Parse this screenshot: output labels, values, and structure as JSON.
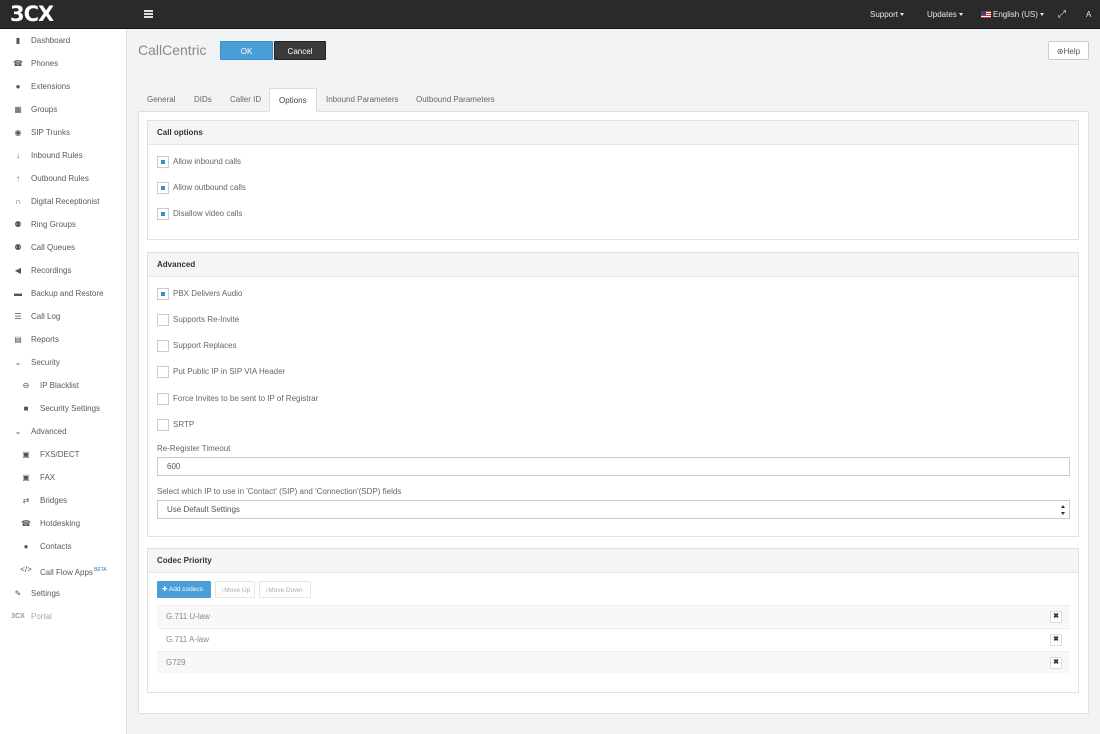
{
  "app": {
    "logo": "3CX"
  },
  "topbar": {
    "support": "Support",
    "updates": "Updates",
    "language": "English (US)",
    "user": "A"
  },
  "sidebar": {
    "items": [
      {
        "label": "Dashboard",
        "icon": "bar-chart-icon"
      },
      {
        "label": "Phones",
        "icon": "phone-icon"
      },
      {
        "label": "Extensions",
        "icon": "user-icon"
      },
      {
        "label": "Groups",
        "icon": "grid-icon"
      },
      {
        "label": "SIP Trunks",
        "icon": "globe-icon"
      },
      {
        "label": "Inbound Rules",
        "icon": "arrow-down-icon"
      },
      {
        "label": "Outbound Rules",
        "icon": "arrow-up-icon"
      },
      {
        "label": "Digital Receptionist",
        "icon": "headset-icon"
      },
      {
        "label": "Ring Groups",
        "icon": "users-icon"
      },
      {
        "label": "Call Queues",
        "icon": "users-icon"
      },
      {
        "label": "Recordings",
        "icon": "speaker-icon"
      },
      {
        "label": "Backup and Restore",
        "icon": "folder-icon"
      },
      {
        "label": "Call Log",
        "icon": "list-icon"
      },
      {
        "label": "Reports",
        "icon": "document-icon"
      },
      {
        "label": "Security",
        "icon": "chevron-down-icon"
      },
      {
        "label": "IP Blacklist",
        "icon": "minus-circle-icon"
      },
      {
        "label": "Security Settings",
        "icon": "lock-icon"
      },
      {
        "label": "Advanced",
        "icon": "chevron-down-icon"
      },
      {
        "label": "FXS/DECT",
        "icon": "fax-icon"
      },
      {
        "label": "FAX",
        "icon": "fax-icon"
      },
      {
        "label": "Bridges",
        "icon": "exchange-icon"
      },
      {
        "label": "Hotdesking",
        "icon": "phone-icon"
      },
      {
        "label": "Contacts",
        "icon": "user-icon"
      },
      {
        "label": "Call Flow Apps",
        "icon": "code-icon",
        "badge": "BETA"
      },
      {
        "label": "Settings",
        "icon": "wrench-icon"
      },
      {
        "label": "Portal",
        "icon": "3cx-icon",
        "icon_text": "3CX"
      }
    ]
  },
  "page": {
    "title": "CallCentric",
    "ok": "OK",
    "cancel": "Cancel",
    "help": "Help"
  },
  "tabs": [
    "General",
    "DIDs",
    "Caller ID",
    "Options",
    "Inbound Parameters",
    "Outbound Parameters"
  ],
  "active_tab": "Options",
  "call_options": {
    "title": "Call options",
    "items": [
      {
        "label": "Allow inbound calls",
        "checked": true
      },
      {
        "label": "Allow outbound calls",
        "checked": true
      },
      {
        "label": "Disallow video calls",
        "checked": true
      }
    ]
  },
  "advanced": {
    "title": "Advanced",
    "items": [
      {
        "label": "PBX Delivers Audio",
        "checked": true
      },
      {
        "label": "Supports Re-Invite",
        "checked": false
      },
      {
        "label": "Support Replaces",
        "checked": false
      },
      {
        "label": "Put Public IP in SIP VIA Header",
        "checked": false
      },
      {
        "label": "Force Invites to be sent to IP of Registrar",
        "checked": false
      },
      {
        "label": "SRTP",
        "checked": false
      }
    ],
    "reregister_label": "Re-Register Timeout",
    "reregister_value": "600",
    "ip_select_label": "Select which IP to use in 'Contact' (SIP) and 'Connection'(SDP) fields",
    "ip_select_value": "Use Default Settings"
  },
  "codec": {
    "title": "Codec Priority",
    "add": "Add codecs",
    "move_up": "Move Up",
    "move_down": "Move Down",
    "rows": [
      "G.711 U-law",
      "G.711 A-law",
      "G729"
    ]
  }
}
